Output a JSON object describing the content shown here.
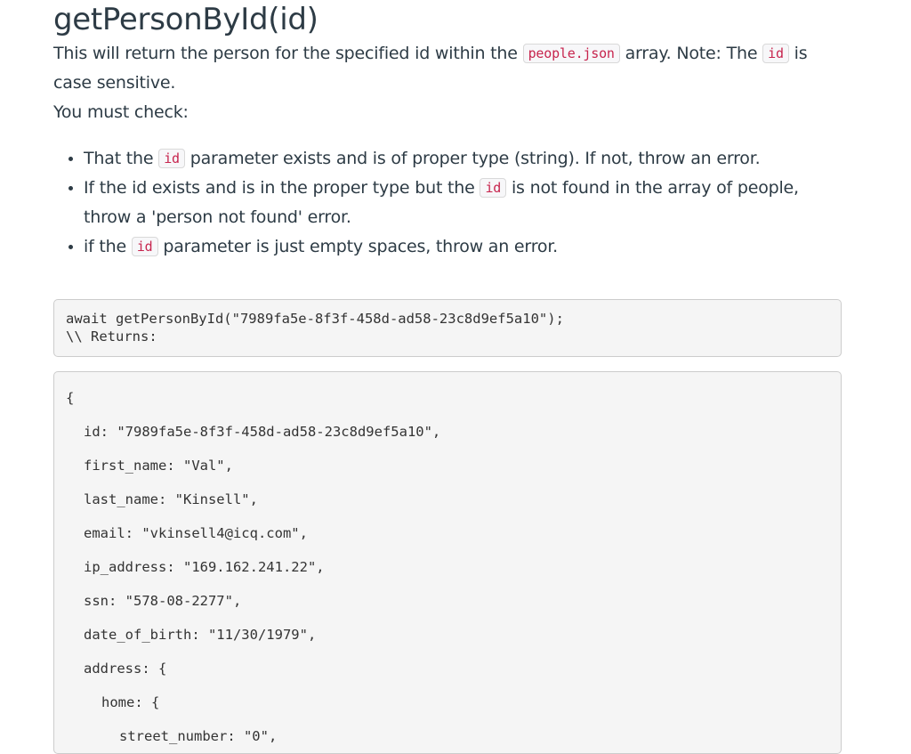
{
  "heading": "getPersonById(id)",
  "intro": {
    "before": "This will return the person for the specified id within the ",
    "code1": "people.json",
    "middle": " array.  Note: The ",
    "code2": "id",
    "after": " is case sensitive."
  },
  "must_check": "You must check:",
  "checks": [
    {
      "before": "That the ",
      "code": "id",
      "after": " parameter exists and is of proper type (string).  If not, throw an error."
    },
    {
      "before": "If the id exists and is in the proper type but  the ",
      "code": "id",
      "after": " is not found in the array of people, throw a 'person not found' error."
    },
    {
      "before": "if the ",
      "code": "id",
      "after": " parameter is just empty spaces, throw an error."
    }
  ],
  "example_call": {
    "line1": "await getPersonById(\"7989fa5e-8f3f-458d-ad58-23c8d9ef5a10\");",
    "line2": "\\\\ Returns:"
  },
  "example_result": {
    "open": "{",
    "id": "id: \"7989fa5e-8f3f-458d-ad58-23c8d9ef5a10\",",
    "first_name": "first_name: \"Val\",",
    "last_name": "last_name: \"Kinsell\",",
    "email": "email: \"vkinsell4@icq.com\",",
    "ip_address": "ip_address: \"169.162.241.22\",",
    "ssn": "ssn: \"578-08-2277\",",
    "date_of_birth": "date_of_birth: \"11/30/1979\",",
    "address": "address: {",
    "home": "home: {",
    "street_number": "street_number: \"0\","
  }
}
